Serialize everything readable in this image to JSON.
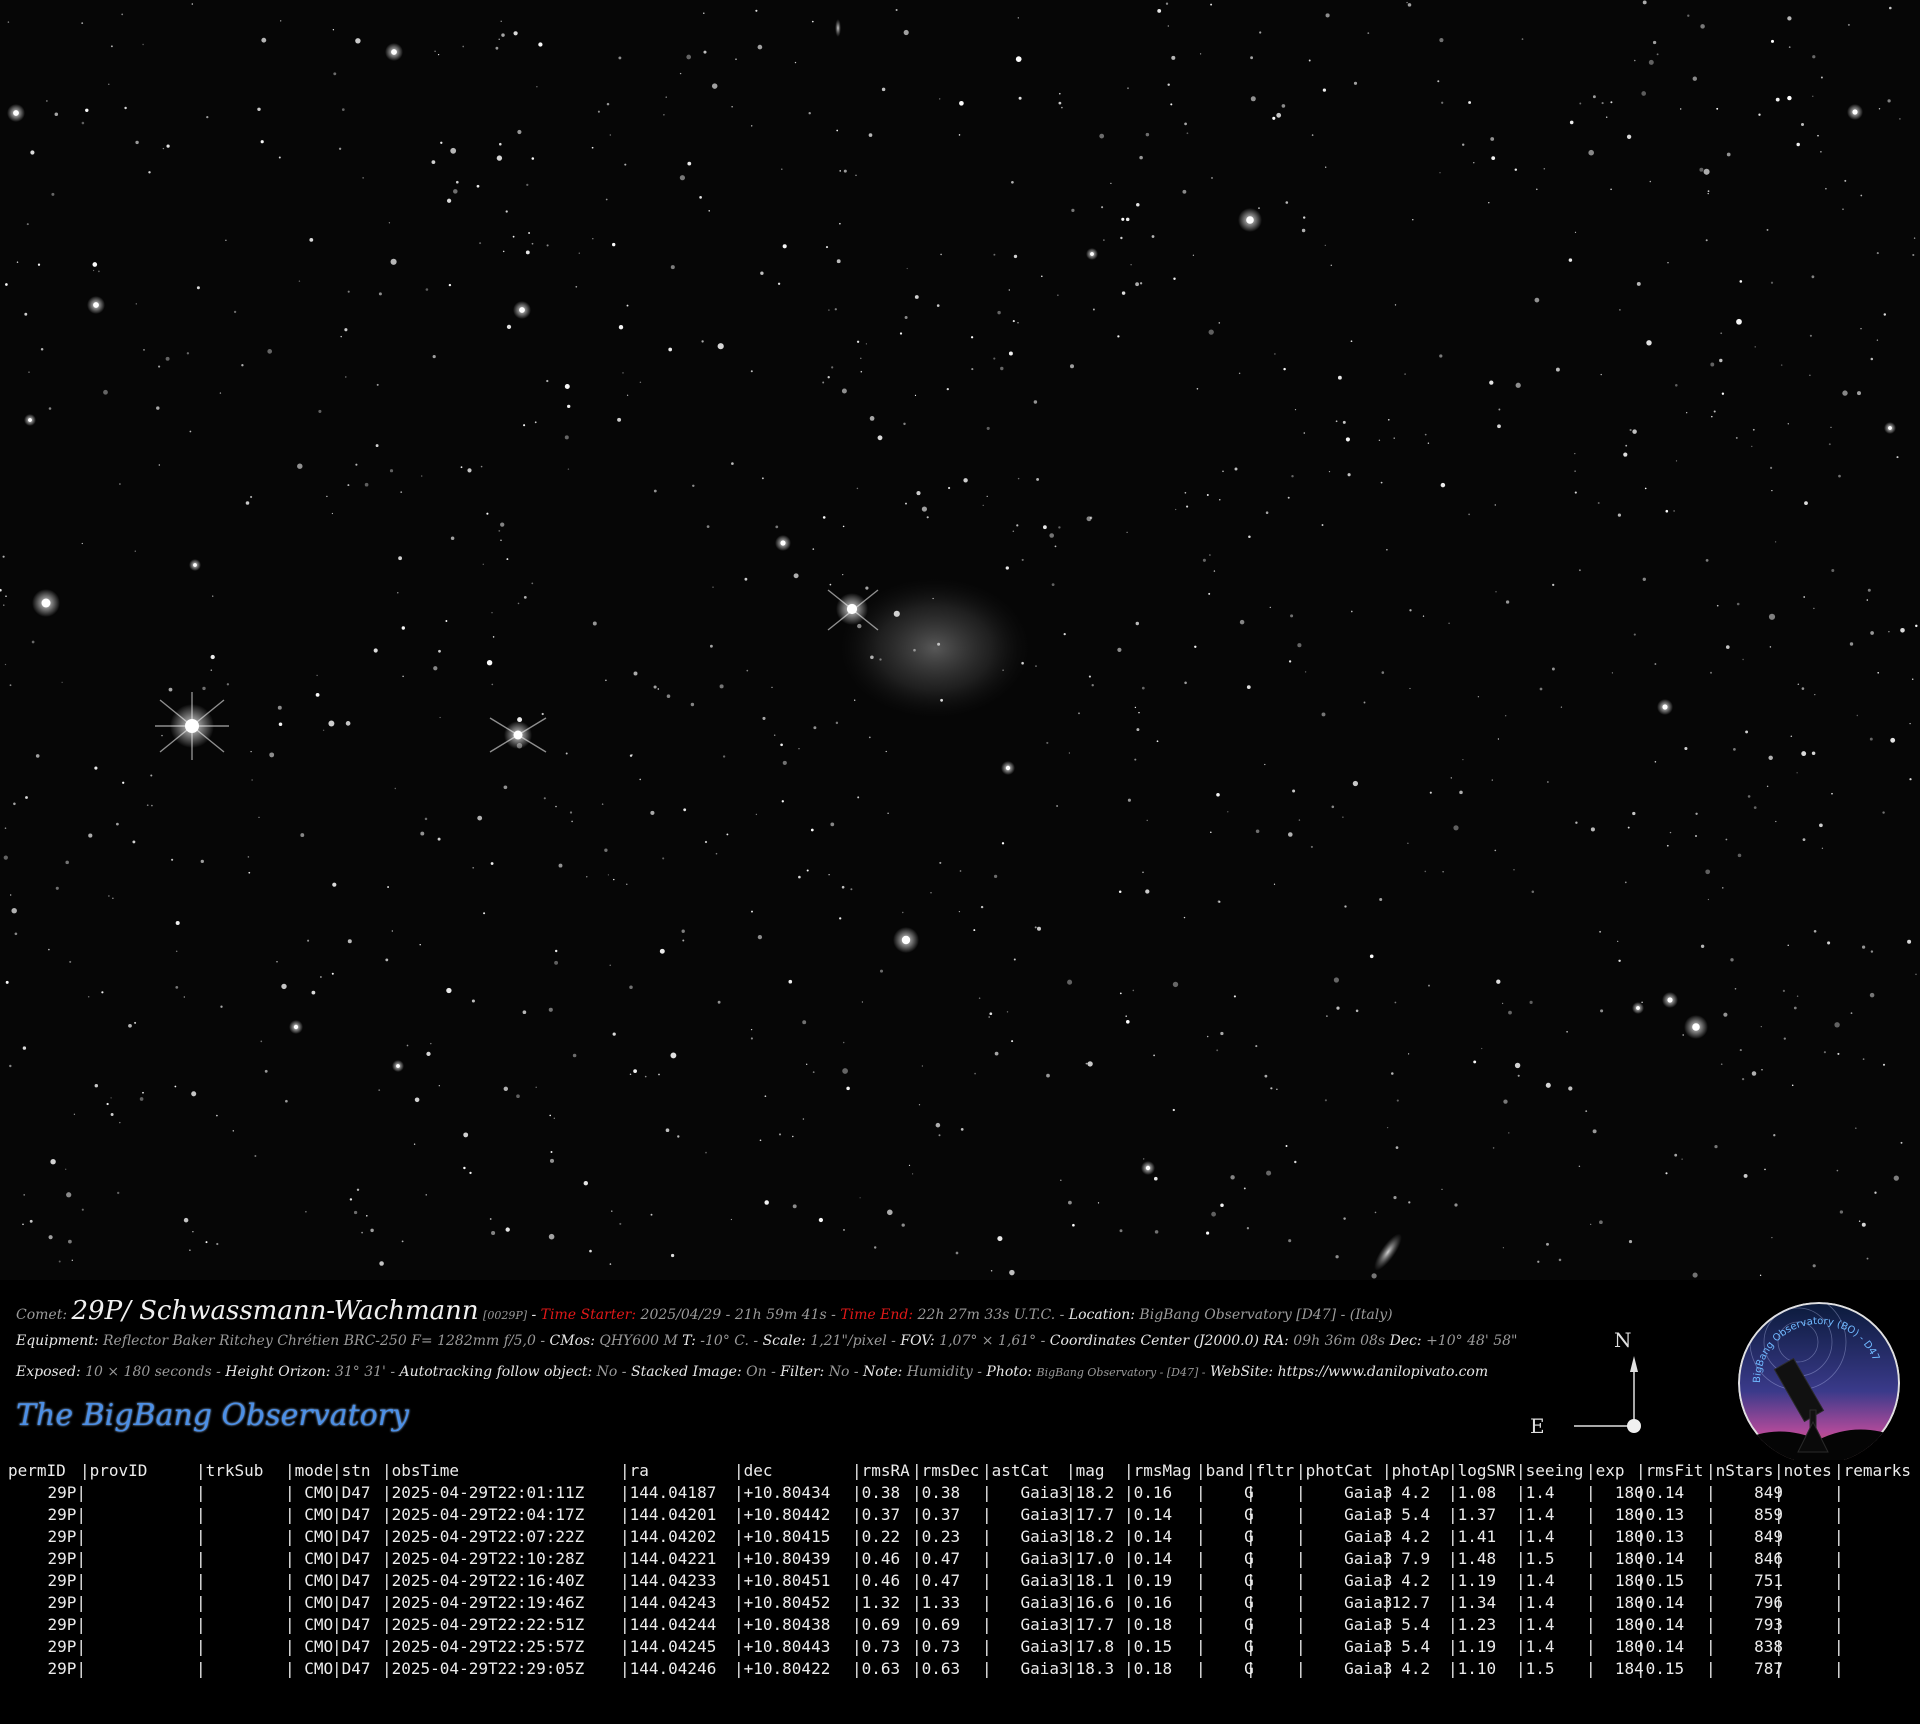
{
  "caption": {
    "comet_label": "Comet:",
    "comet_name": "29P/ Schwassmann-Wachmann",
    "comet_code": "[0029P]",
    "dash1": "-",
    "time_start_label": "Time Starter:",
    "time_start_value": "2025/04/29  -  21h 59m 41s  -",
    "time_end_label": "Time End:",
    "time_end_value": "22h  27m 33s  U.T.C. -",
    "location_label": "Location:",
    "location_value": "BigBang Observatory  [D47] - (Italy)",
    "equipment_label": "Equipment:",
    "equipment_value": "Reflector Baker Ritchey Chrétien BRC-250  F= 1282mm f/5,0  -",
    "cmos_label": "CMos:",
    "cmos_value": "QHY600 M",
    "temp_label": "T:",
    "temp_value": "-10° C. -",
    "scale_label": "Scale:",
    "scale_value": "1,21\"/pixel  -",
    "fov_label": "FOV:",
    "fov_value": "1,07° × 1,61°  -",
    "coords_label": "Coordinates Center (J2000.0) RA:",
    "ra_value": "09h 36m 08s",
    "dec_label": "Dec:",
    "dec_value": "+10° 48' 58\"",
    "exposed_label": "Exposed:",
    "exposed_value": "10 × 180 seconds  -",
    "height_label": "Height Orizon:",
    "height_value": "31° 31' -",
    "autotrack_label": "Autotracking follow object:",
    "autotrack_value": "No -",
    "stacked_label": "Stacked Image:",
    "stacked_value": "On -",
    "filter_label": "Filter:",
    "filter_value": "No  -",
    "note_label": "Note:",
    "note_value": "Humidity -",
    "photo_label": "Photo:",
    "photo_value": "BigBang Observatory - [D47] -",
    "website_label": "WebSite:",
    "website_value": "https://www.danilopivato.com",
    "brand": "The BigBang Observatory"
  },
  "compass": {
    "north": "N",
    "east": "E"
  },
  "logo": {
    "text": "BigBang Observatory (BO) - D47"
  },
  "report": {
    "columns": [
      "permID",
      "|provID",
      "|trkSub",
      "|mode",
      "|stn",
      "|obsTime",
      "|ra",
      "|dec",
      "|rmsRA",
      "|rmsDec",
      "|astCat",
      "|mag",
      "|rmsMag",
      "|band",
      "|fltr",
      "|photCat",
      "|photAp",
      "|logSNR",
      "|seeing",
      "|exp",
      "|rmsFit",
      "|nStars",
      "|notes",
      "|remarks"
    ],
    "rows": [
      [
        "29P|",
        "",
        "|",
        "| CMO",
        "|D47",
        "|2025-04-29T22:01:11Z",
        "|144.04187",
        "|+10.80434",
        "|0.38",
        "|0.38",
        "|   Gaia3",
        "|18.2",
        "|0.16",
        "|    G",
        "|",
        "|    Gaia3",
        "| 4.2",
        "|1.08",
        "|1.4",
        "|  180",
        "|0.14",
        "|    849",
        "|",
        "|"
      ],
      [
        "29P|",
        "",
        "|",
        "| CMO",
        "|D47",
        "|2025-04-29T22:04:17Z",
        "|144.04201",
        "|+10.80442",
        "|0.37",
        "|0.37",
        "|   Gaia3",
        "|17.7",
        "|0.14",
        "|    G",
        "|",
        "|    Gaia3",
        "| 5.4",
        "|1.37",
        "|1.4",
        "|  180",
        "|0.13",
        "|    859",
        "|",
        "|"
      ],
      [
        "29P|",
        "",
        "|",
        "| CMO",
        "|D47",
        "|2025-04-29T22:07:22Z",
        "|144.04202",
        "|+10.80415",
        "|0.22",
        "|0.23",
        "|   Gaia3",
        "|18.2",
        "|0.14",
        "|    G",
        "|",
        "|    Gaia3",
        "| 4.2",
        "|1.41",
        "|1.4",
        "|  180",
        "|0.13",
        "|    849",
        "|",
        "|"
      ],
      [
        "29P|",
        "",
        "|",
        "| CMO",
        "|D47",
        "|2025-04-29T22:10:28Z",
        "|144.04221",
        "|+10.80439",
        "|0.46",
        "|0.47",
        "|   Gaia3",
        "|17.0",
        "|0.14",
        "|    G",
        "|",
        "|    Gaia3",
        "| 7.9",
        "|1.48",
        "|1.5",
        "|  180",
        "|0.14",
        "|    846",
        "|",
        "|"
      ],
      [
        "29P|",
        "",
        "|",
        "| CMO",
        "|D47",
        "|2025-04-29T22:16:40Z",
        "|144.04233",
        "|+10.80451",
        "|0.46",
        "|0.47",
        "|   Gaia3",
        "|18.1",
        "|0.19",
        "|    G",
        "|",
        "|    Gaia3",
        "| 4.2",
        "|1.19",
        "|1.4",
        "|  180",
        "|0.15",
        "|    751",
        "|",
        "|"
      ],
      [
        "29P|",
        "",
        "|",
        "| CMO",
        "|D47",
        "|2025-04-29T22:19:46Z",
        "|144.04243",
        "|+10.80452",
        "|1.32",
        "|1.33",
        "|   Gaia3",
        "|16.6",
        "|0.16",
        "|    G",
        "|",
        "|    Gaia3",
        "|12.7",
        "|1.34",
        "|1.4",
        "|  180",
        "|0.14",
        "|    796",
        "|",
        "|"
      ],
      [
        "29P|",
        "",
        "|",
        "| CMO",
        "|D47",
        "|2025-04-29T22:22:51Z",
        "|144.04244",
        "|+10.80438",
        "|0.69",
        "|0.69",
        "|   Gaia3",
        "|17.7",
        "|0.18",
        "|    G",
        "|",
        "|    Gaia3",
        "| 5.4",
        "|1.23",
        "|1.4",
        "|  180",
        "|0.14",
        "|    793",
        "|",
        "|"
      ],
      [
        "29P|",
        "",
        "|",
        "| CMO",
        "|D47",
        "|2025-04-29T22:25:57Z",
        "|144.04245",
        "|+10.80443",
        "|0.73",
        "|0.73",
        "|   Gaia3",
        "|17.8",
        "|0.15",
        "|    G",
        "|",
        "|    Gaia3",
        "| 5.4",
        "|1.19",
        "|1.4",
        "|  180",
        "|0.14",
        "|    838",
        "|",
        "|"
      ],
      [
        "29P|",
        "",
        "|",
        "| CMO",
        "|D47",
        "|2025-04-29T22:29:05Z",
        "|144.04246",
        "|+10.80422",
        "|0.63",
        "|0.63",
        "|   Gaia3",
        "|18.3",
        "|0.18",
        "|    G",
        "|",
        "|    Gaia3",
        "| 4.2",
        "|1.10",
        "|1.5",
        "|  184",
        "|0.15",
        "|    787",
        "|",
        "|"
      ]
    ]
  }
}
